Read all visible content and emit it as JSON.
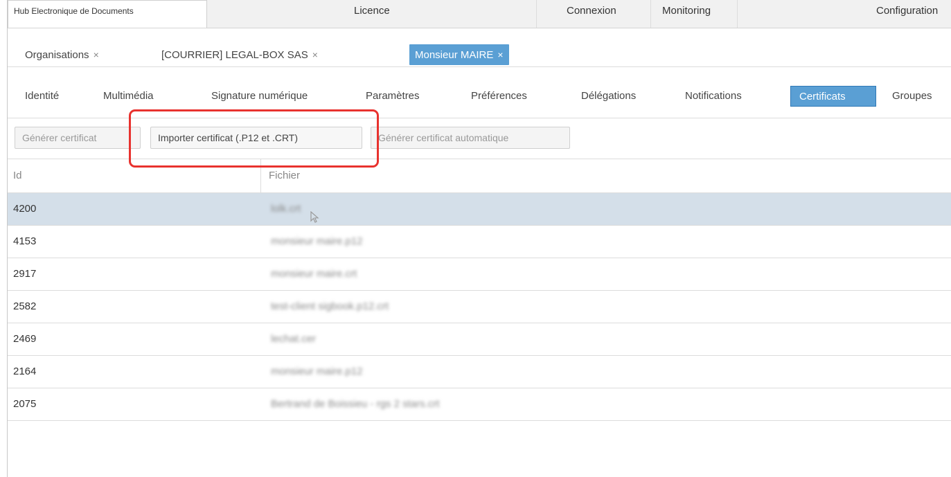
{
  "top_nav": {
    "app_tab": "Hub Electronique de Documents",
    "licence": "Licence",
    "connexion": "Connexion",
    "monitoring": "Monitoring",
    "configuration": "Configuration"
  },
  "open_tabs": [
    {
      "label": "Organisations",
      "close": "×"
    },
    {
      "label": "[COURRIER] LEGAL-BOX SAS",
      "close": "×"
    },
    {
      "label": "Monsieur MAIRE",
      "close": "×",
      "active": true
    }
  ],
  "sub_tabs": [
    {
      "label": "Identité"
    },
    {
      "label": "Multimédia"
    },
    {
      "label": "Signature numérique"
    },
    {
      "label": "Paramètres"
    },
    {
      "label": "Préférences"
    },
    {
      "label": "Délégations"
    },
    {
      "label": "Notifications"
    },
    {
      "label": "Certificats",
      "active": true
    },
    {
      "label": "Groupes"
    }
  ],
  "toolbar": {
    "generate": "Générer certificat",
    "import": "Importer certificat (.P12 et .CRT)",
    "generate_auto": "Générer certificat automatique"
  },
  "table": {
    "columns": [
      "Id",
      "Fichier"
    ],
    "rows": [
      {
        "id": "4200",
        "file": "lolk.crt"
      },
      {
        "id": "4153",
        "file": "monsieur maire.p12"
      },
      {
        "id": "2917",
        "file": "monsieur maire.crt"
      },
      {
        "id": "2582",
        "file": "test-client sigbook.p12.crt"
      },
      {
        "id": "2469",
        "file": "lechat.cer"
      },
      {
        "id": "2164",
        "file": "monsieur maire.p12"
      },
      {
        "id": "2075",
        "file": "Bertrand de Boissieu - rgs 2 stars.crt"
      }
    ],
    "selected_row": 0
  },
  "colors": {
    "accent": "#5a9fd4",
    "selected_row": "#d4dfe9",
    "highlight": "#e8322e"
  }
}
